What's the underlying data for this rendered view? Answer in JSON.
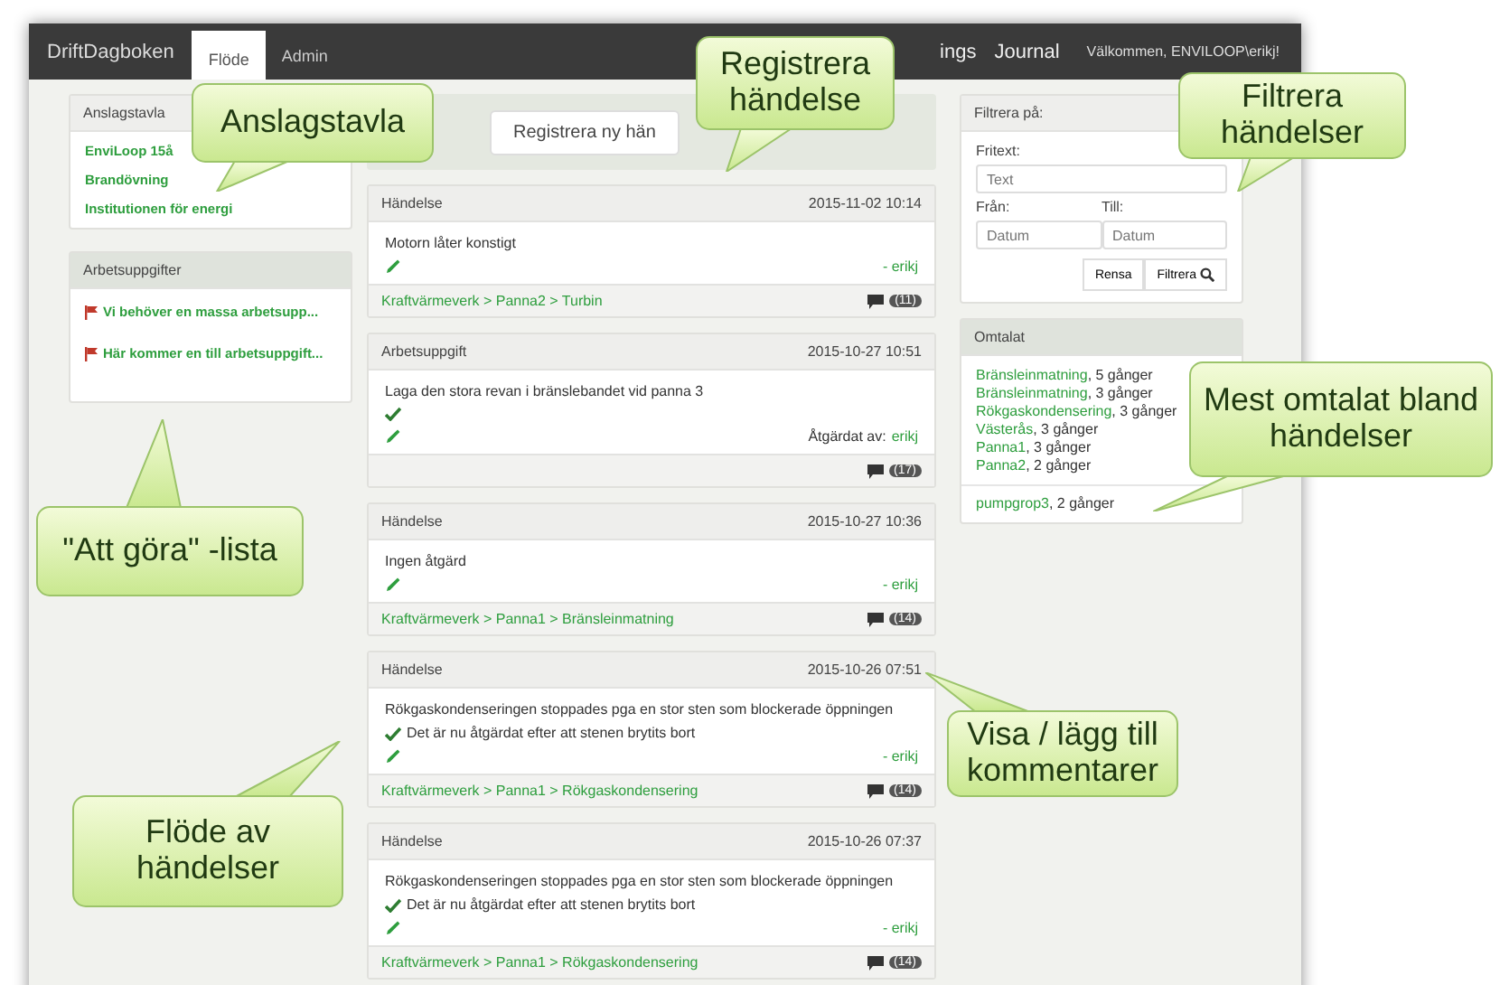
{
  "navbar": {
    "brand": "DriftDagboken",
    "tabs": [
      {
        "label": "Flöde",
        "selected": true
      },
      {
        "label": "Admin",
        "selected": false
      }
    ],
    "links": [
      "ings",
      "Journal"
    ],
    "welcome": "Välkommen, ENVILOOP\\erikj!"
  },
  "notice_board": {
    "title": "Anslagstavla",
    "items": [
      "EnviLoop 15å",
      "Brandövning",
      "Institutionen för energi"
    ]
  },
  "tasks": {
    "title": "Arbetsuppgifter",
    "items": [
      "Vi behöver en massa arbetsupp...",
      "Här kommer en till arbetsuppgift..."
    ]
  },
  "register_button": "Registrera ny hän",
  "events": [
    {
      "type": "Händelse",
      "time": "2015-11-02 10:14",
      "text": "Motorn låter konstigt",
      "resolved": false,
      "author": "- erikj",
      "path": "Kraftvärmeverk > Panna2 > Turbin",
      "comments": "(11)"
    },
    {
      "type": "Arbetsuppgift",
      "time": "2015-10-27 10:51",
      "text": "Laga den stora revan i bränslebandet vid panna 3",
      "resolved": true,
      "author_label": "Åtgärdat av:",
      "author": "erikj",
      "comments": "(17)"
    },
    {
      "type": "Händelse",
      "time": "2015-10-27 10:36",
      "text": "Ingen åtgärd",
      "resolved": false,
      "author": "- erikj",
      "path": "Kraftvärmeverk > Panna1 > Bränsleinmatning",
      "comments": "(14)"
    },
    {
      "type": "Händelse",
      "time": "2015-10-26 07:51",
      "text": "Rökgaskondenseringen stoppades pga en stor sten som blockerade öppningen",
      "resolved": true,
      "resolution": "Det är nu åtgärdat efter att stenen brytits bort",
      "author": "- erikj",
      "path": "Kraftvärmeverk > Panna1 > Rökgaskondensering",
      "comments": "(14)"
    },
    {
      "type": "Händelse",
      "time": "2015-10-26 07:37",
      "text": "Rökgaskondenseringen stoppades pga en stor sten som blockerade öppningen",
      "resolved": true,
      "resolution": "Det är nu åtgärdat efter att stenen brytits bort",
      "author": "- erikj",
      "path": "Kraftvärmeverk > Panna1 > Rökgaskondensering",
      "comments": "(14)"
    }
  ],
  "filter": {
    "title": "Filtrera på:",
    "free_text_label": "Fritext:",
    "free_text_placeholder": "Text",
    "from_label": "Från:",
    "to_label": "Till:",
    "from_placeholder": "Datum",
    "to_placeholder": "Datum",
    "clear_button": "Rensa",
    "filter_button": "Filtrera"
  },
  "mentioned": {
    "title": "Omtalat",
    "items": [
      {
        "name": "Bränsleinmatning",
        "count": ", 5 gånger"
      },
      {
        "name": "Bränsleinmatning",
        "count": ", 3 gånger"
      },
      {
        "name": "Rökgaskondensering",
        "count": ", 3 gånger"
      },
      {
        "name": "Västerås",
        "count": ", 3 gånger"
      },
      {
        "name": "Panna1",
        "count": ", 3 gånger"
      },
      {
        "name": "Panna2",
        "count": ", 2 gånger"
      }
    ],
    "extra_items": [
      {
        "name": "pumpgrop3",
        "count": ", 2 gånger"
      }
    ]
  },
  "callouts": [
    "Anslagstavla",
    "Registrera händelse",
    "Filtrera händelser",
    "Mest omtalat bland händelser",
    "\"Att göra\" -lista",
    "Flöde av händelser",
    "Visa / lägg till kommentarer"
  ]
}
